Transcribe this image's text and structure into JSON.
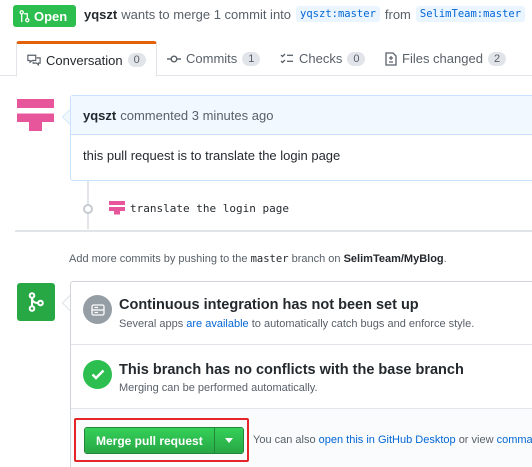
{
  "header": {
    "state_label": "Open",
    "author": "yqszt",
    "text_wants": "wants to merge 1 commit into",
    "base_branch": "yqszt:master",
    "text_from": "from",
    "head_branch": "SelimTeam:master"
  },
  "tabs": [
    {
      "label": "Conversation",
      "count": "0",
      "icon": "conversation-icon"
    },
    {
      "label": "Commits",
      "count": "1",
      "icon": "commit-icon"
    },
    {
      "label": "Checks",
      "count": "0",
      "icon": "checks-icon"
    },
    {
      "label": "Files changed",
      "count": "2",
      "icon": "file-diff-icon"
    }
  ],
  "comment": {
    "author": "yqszt",
    "meta": "commented 3 minutes ago",
    "body": "this pull request is to translate the login page"
  },
  "commit": {
    "message": "translate the login page"
  },
  "add_more": {
    "prefix": "Add more commits by pushing to the",
    "branch": "master",
    "middle": "branch on",
    "repo": "SelimTeam/MyBlog",
    "suffix": "."
  },
  "merge": {
    "ci_title": "Continuous integration has not been set up",
    "ci_sub_prefix": "Several apps",
    "ci_sub_link": "are available",
    "ci_sub_suffix": "to automatically catch bugs and enforce style.",
    "ok_title": "This branch has no conflicts with the base branch",
    "ok_sub": "Merging can be performed automatically.",
    "button_label": "Merge pull request",
    "also_prefix": "You can also",
    "also_link": "open this in GitHub Desktop",
    "also_middle": "or view",
    "also_link2": "comman"
  },
  "colors": {
    "open_green": "#2cbe4e",
    "merge_green": "#28a745",
    "link_blue": "#0366d6",
    "highlight_red": "#e3252a",
    "tab_accent": "#e36209"
  }
}
